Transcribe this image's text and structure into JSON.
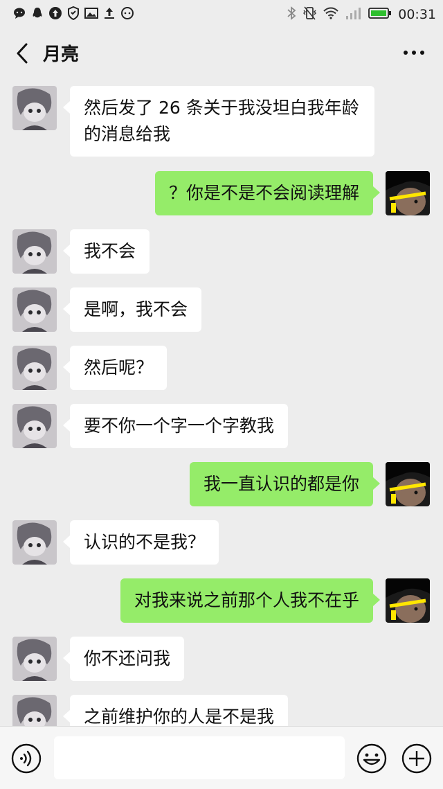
{
  "status_bar": {
    "time": "00:31",
    "left_icons": [
      "chat-bubble-icon",
      "qq-icon",
      "upload-circle-icon",
      "shield-icon",
      "image-icon",
      "upload-arrow-icon",
      "ring-icon"
    ],
    "right_icons": [
      "bluetooth-icon",
      "vibrate-icon",
      "wifi-icon",
      "signal-icon",
      "battery-icon"
    ]
  },
  "header": {
    "title": "月亮",
    "back_icon": "chevron-left-icon",
    "more_icon": "more-dots-icon"
  },
  "messages": [
    {
      "side": "left",
      "text": "然后发了 26 条关于我没坦白我年龄的消息给我"
    },
    {
      "side": "right",
      "text": "？你是不是不会阅读理解"
    },
    {
      "side": "left",
      "text": "我不会"
    },
    {
      "side": "left",
      "text": "是啊，我不会"
    },
    {
      "side": "left",
      "text": "然后呢？"
    },
    {
      "side": "left",
      "text": "要不你一个字一个字教我"
    },
    {
      "side": "right",
      "text": "我一直认识的都是你"
    },
    {
      "side": "left",
      "text": "认识的不是我？"
    },
    {
      "side": "right",
      "text": "对我来说之前那个人我不在乎"
    },
    {
      "side": "left",
      "text": "你不还问我"
    },
    {
      "side": "left",
      "text": "之前维护你的人是不是我"
    }
  ],
  "input_bar": {
    "value": "",
    "placeholder": "",
    "voice_icon": "voice-icon",
    "emoji_icon": "emoji-icon",
    "plus_icon": "plus-icon"
  },
  "colors": {
    "background": "#ededed",
    "bubble_left": "#ffffff",
    "bubble_right": "#95ec69"
  }
}
